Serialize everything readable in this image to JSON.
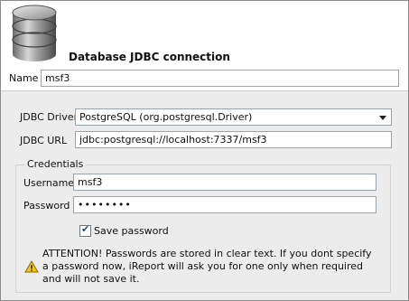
{
  "header": {
    "title": "Database JDBC connection",
    "icon": "database-icon"
  },
  "name": {
    "label": "Name",
    "value": "msf3"
  },
  "jdbc": {
    "driver_label": "JDBC Driver",
    "driver_value": "PostgreSQL (org.postgresql.Driver)",
    "url_label": "JDBC URL",
    "url_value": "jdbc:postgresql://localhost:7337/msf3"
  },
  "credentials": {
    "title": "Credentials",
    "username_label": "Username",
    "username_value": "msf3",
    "password_label": "Password",
    "password_value": "••••••••",
    "save_password_label": "Save password",
    "save_password_checked": true
  },
  "warning": {
    "icon": "warning-icon",
    "text": "ATTENTION! Passwords are stored in clear text. If you dont specify a password now, iReport will ask you for one only when required and will not save it."
  }
}
